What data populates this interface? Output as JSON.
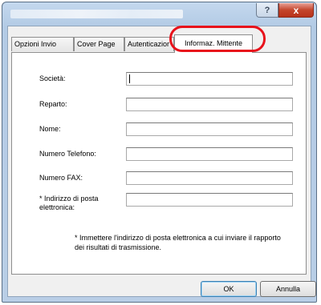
{
  "window": {
    "help_symbol": "?",
    "close_symbol": "x"
  },
  "tabs": [
    {
      "label": "Opzioni Invio"
    },
    {
      "label": "Cover Page"
    },
    {
      "label": "Autenticazior"
    },
    {
      "label": "Informaz. Mittente",
      "active": true
    }
  ],
  "form": {
    "fields": [
      {
        "label": "Società:",
        "value": ""
      },
      {
        "label": "Reparto:",
        "value": ""
      },
      {
        "label": "Nome:",
        "value": ""
      },
      {
        "label": "Numero Telefono:",
        "value": ""
      },
      {
        "label": "Numero FAX:",
        "value": ""
      },
      {
        "label": "* Indirizzo di posta elettronica:",
        "value": ""
      }
    ],
    "note": "* Immettere l'indirizzo di posta elettronica a cui inviare il rapporto dei risultati di trasmissione."
  },
  "buttons": {
    "ok": "OK",
    "cancel": "Annulla"
  },
  "colors": {
    "highlight": "#e8121b",
    "close_button": "#c4452c"
  }
}
